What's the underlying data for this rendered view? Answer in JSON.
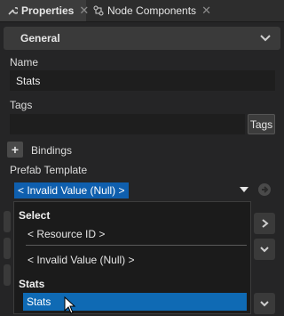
{
  "tabs": [
    {
      "label": "Properties",
      "icon": "wrench-icon"
    },
    {
      "label": "Node Components",
      "icon": "node-components-icon"
    }
  ],
  "section": {
    "title": "General"
  },
  "name": {
    "label": "Name",
    "value": "Stats"
  },
  "tags": {
    "label": "Tags",
    "value": "",
    "button": "Tags"
  },
  "bindings": {
    "label": "Bindings",
    "add": "+"
  },
  "prefab": {
    "label": "Prefab Template",
    "value": "< Invalid Value (Null) >"
  },
  "dropdown": {
    "group1": "Select",
    "item_resource": "< Resource ID >",
    "item_invalid": "< Invalid Value (Null) >",
    "group2": "Stats",
    "item_stats": "Stats"
  },
  "colors": {
    "accent": "#0f6ab4",
    "panel": "#252526",
    "header": "#3a3a3a"
  }
}
